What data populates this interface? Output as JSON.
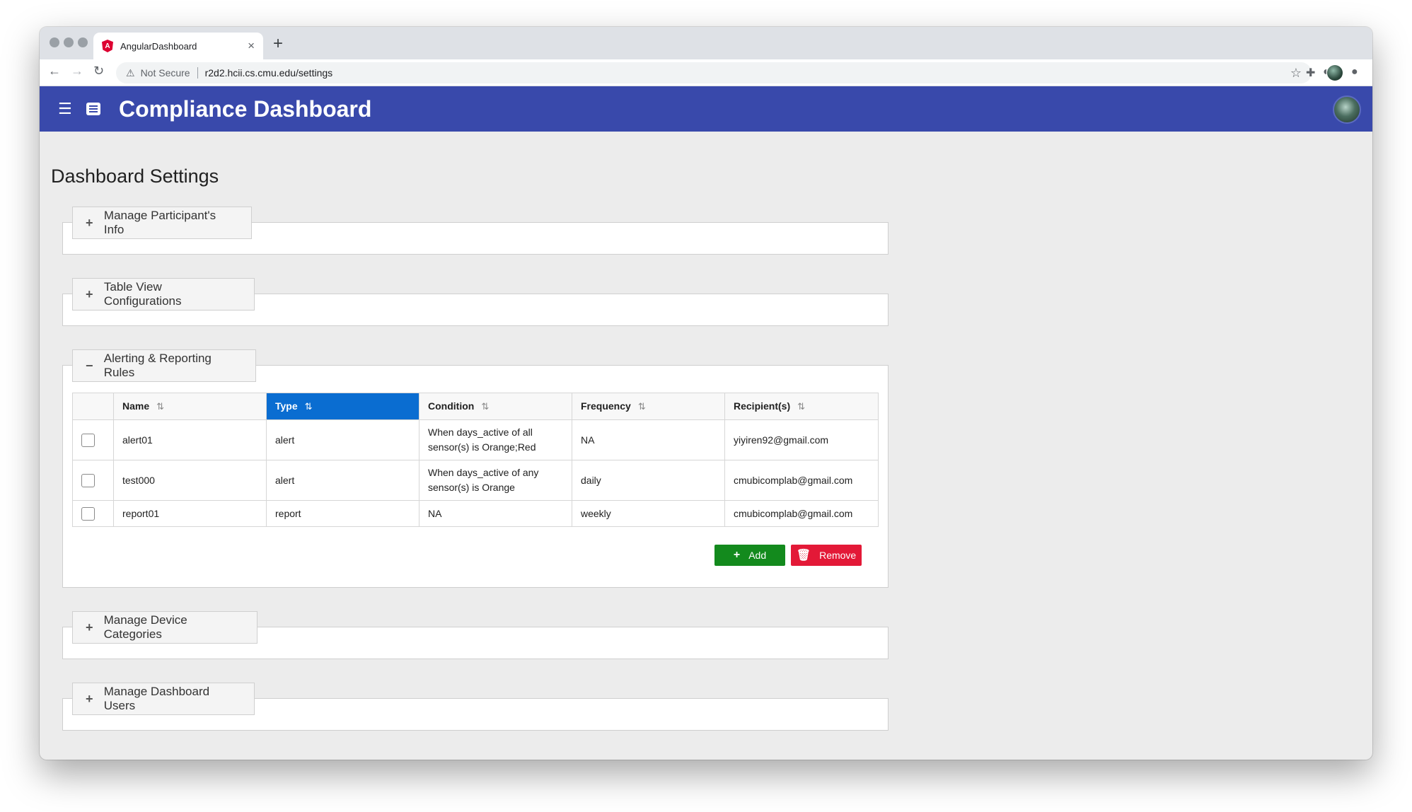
{
  "browser": {
    "tab_title": "AngularDashboard",
    "tab_close": "×",
    "new_tab": "+",
    "not_secure": "Not Secure",
    "url": "r2d2.hcii.cs.cmu.edu/settings"
  },
  "header": {
    "title": "Compliance Dashboard"
  },
  "page": {
    "title": "Dashboard Settings"
  },
  "panels": [
    {
      "label": "Manage Participant's Info",
      "expanded": false
    },
    {
      "label": "Table View Configurations",
      "expanded": false
    },
    {
      "label": "Alerting & Reporting Rules",
      "expanded": true
    },
    {
      "label": "Manage Device Categories",
      "expanded": false
    },
    {
      "label": "Manage Dashboard Users",
      "expanded": false
    }
  ],
  "rules_table": {
    "columns": [
      "Name",
      "Type",
      "Condition",
      "Frequency",
      "Recipient(s)"
    ],
    "sorted_column": "Type",
    "rows": [
      {
        "name": "alert01",
        "type": "alert",
        "condition": "When days_active of all sensor(s) is Orange;Red",
        "frequency": "NA",
        "recipients": "yiyiren92@gmail.com"
      },
      {
        "name": "test000",
        "type": "alert",
        "condition": "When days_active of any sensor(s) is Orange",
        "frequency": "daily",
        "recipients": "cmubicomplab@gmail.com"
      },
      {
        "name": "report01",
        "type": "report",
        "condition": "NA",
        "frequency": "weekly",
        "recipients": "cmubicomplab@gmail.com"
      }
    ]
  },
  "actions": {
    "add_label": "Add",
    "remove_label": "Remove"
  },
  "colors": {
    "header": "#3949ab",
    "sorted_header": "#0a6dd1",
    "add": "#138a1d",
    "remove": "#e31937"
  },
  "icons": {
    "expand": "+",
    "collapse": "−",
    "sort": "⇅"
  }
}
